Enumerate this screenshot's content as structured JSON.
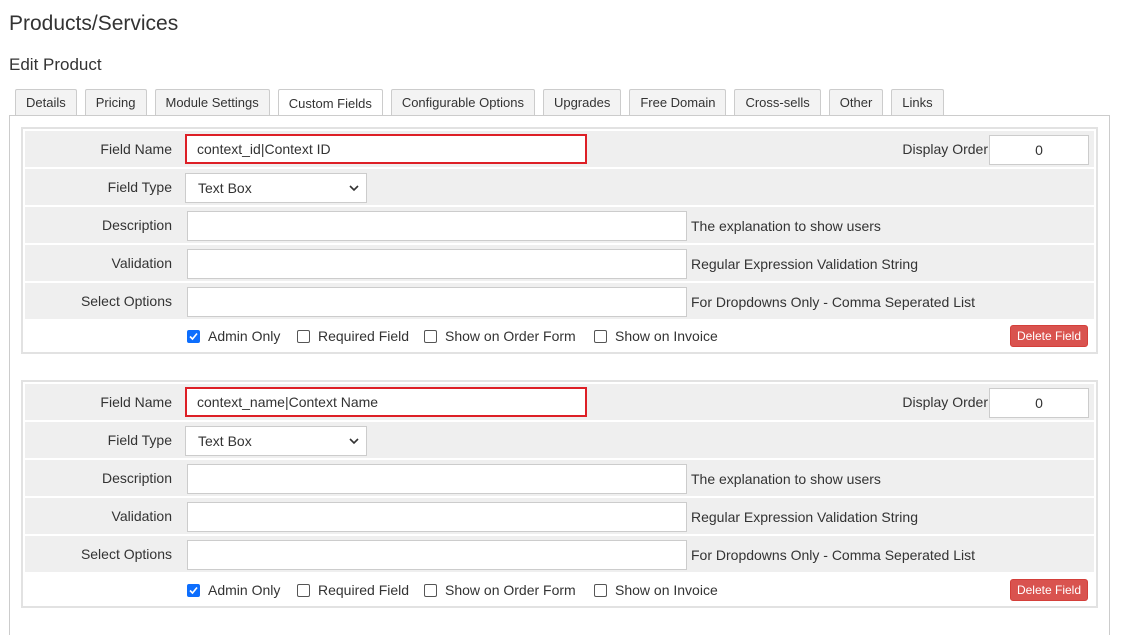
{
  "page": {
    "title": "Products/Services",
    "subtitle": "Edit Product"
  },
  "tabs": [
    {
      "label": "Details"
    },
    {
      "label": "Pricing"
    },
    {
      "label": "Module Settings"
    },
    {
      "label": "Custom Fields"
    },
    {
      "label": "Configurable Options"
    },
    {
      "label": "Upgrades"
    },
    {
      "label": "Free Domain"
    },
    {
      "label": "Cross-sells"
    },
    {
      "label": "Other"
    },
    {
      "label": "Links"
    }
  ],
  "active_tab": "Custom Fields",
  "labels": {
    "field_name": "Field Name",
    "field_type": "Field Type",
    "description": "Description",
    "validation": "Validation",
    "select_options": "Select Options",
    "display_order": "Display Order",
    "admin_only": "Admin Only",
    "required_field": "Required Field",
    "show_on_order_form": "Show on Order Form",
    "show_on_invoice": "Show on Invoice",
    "delete_field": "Delete Field",
    "description_hint": "The explanation to show users",
    "validation_hint": "Regular Expression Validation String",
    "select_options_hint": "For Dropdowns Only - Comma Seperated List"
  },
  "fields": [
    {
      "field_name": "context_id|Context ID",
      "field_type": "Text Box",
      "display_order": "0",
      "description": "",
      "validation": "",
      "select_options": "",
      "admin_only": true,
      "required_field": false,
      "show_on_order_form": false,
      "show_on_invoice": false
    },
    {
      "field_name": "context_name|Context Name",
      "field_type": "Text Box",
      "display_order": "0",
      "description": "",
      "validation": "",
      "select_options": "",
      "admin_only": true,
      "required_field": false,
      "show_on_order_form": false,
      "show_on_invoice": false
    }
  ],
  "colors": {
    "highlight_border": "#dd1f26",
    "delete_button": "#d9534f",
    "checkbox_checked": "#0d6efd",
    "row_background": "#efefef"
  },
  "icons": {
    "select_arrow": "chevron-down-icon",
    "checkbox_mark": "checkmark-icon"
  }
}
